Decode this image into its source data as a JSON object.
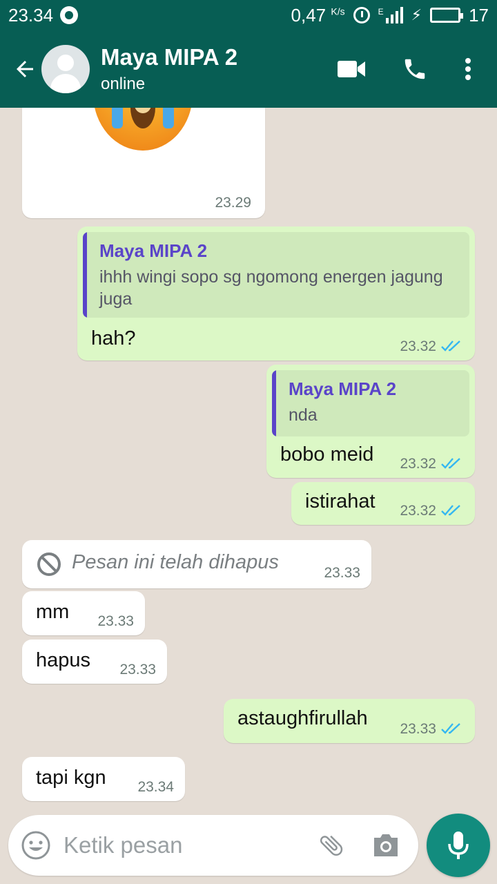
{
  "status_bar": {
    "time": "23.34",
    "speed": "0,47",
    "speed_unit": "K/s",
    "battery": "17",
    "network_type": "E"
  },
  "header": {
    "contact_name": "Maya MIPA 2",
    "status": "online"
  },
  "messages": [
    {
      "direction": "in",
      "type": "sticker",
      "time": "23.29"
    },
    {
      "direction": "out",
      "quote_name": "Maya MIPA 2",
      "quote_text": "ihhh wingi sopo sg ngomong energen jagung juga",
      "text": "hah?",
      "time": "23.32",
      "status": "read"
    },
    {
      "direction": "out",
      "quote_name": "Maya MIPA 2",
      "quote_text": "nda",
      "text": "bobo meid",
      "time": "23.32",
      "status": "read"
    },
    {
      "direction": "out",
      "text": "istirahat",
      "time": "23.32",
      "status": "read"
    },
    {
      "direction": "in",
      "type": "deleted",
      "text": "Pesan ini telah dihapus",
      "time": "23.33"
    },
    {
      "direction": "in",
      "text": "mm",
      "time": "23.33"
    },
    {
      "direction": "in",
      "text": "hapus",
      "time": "23.33"
    },
    {
      "direction": "out",
      "text": "astaughfirullah",
      "time": "23.33",
      "status": "read"
    },
    {
      "direction": "in",
      "text": "tapi kgn",
      "time": "23.34"
    }
  ],
  "composer": {
    "placeholder": "Ketik pesan"
  },
  "colors": {
    "header": "#075e54",
    "outgoing_bubble": "#dcf8c6",
    "incoming_bubble": "#ffffff",
    "read_ticks": "#34b7f1",
    "fab": "#128c7e",
    "quote_accent": "#5a44c9"
  }
}
